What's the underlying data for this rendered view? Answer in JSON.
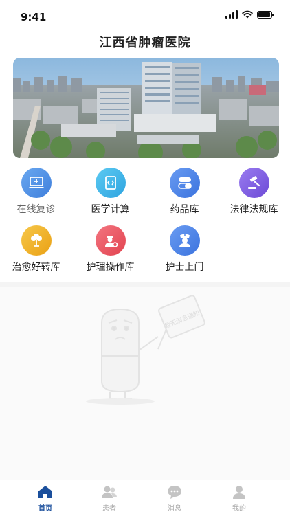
{
  "status_bar": {
    "time": "9:41"
  },
  "header": {
    "title": "江西省肿瘤医院"
  },
  "banner": {
    "alt_icon": "hospital-building-photo"
  },
  "services": [
    {
      "label": "在线复诊",
      "icon": "laptop-plus-icon",
      "color": "#4a8fe0"
    },
    {
      "label": "医学计算",
      "icon": "code-book-icon",
      "color": "#3fb7e8"
    },
    {
      "label": "药品库",
      "icon": "capsule-icon",
      "color": "#4d86e8"
    },
    {
      "label": "法律法规库",
      "icon": "gavel-icon",
      "color": "#7d5be0"
    },
    {
      "label": "治愈好转库",
      "icon": "tree-icon",
      "color": "#f0b428"
    },
    {
      "label": "护理操作库",
      "icon": "nurse-gear-icon",
      "color": "#ee5b67"
    },
    {
      "label": "护士上门",
      "icon": "nurse-icon",
      "color": "#4d86e8"
    }
  ],
  "empty_state": {
    "sign_text": "暂无消息通知"
  },
  "tabbar": {
    "items": [
      {
        "label": "首页",
        "icon": "home-icon",
        "active": true
      },
      {
        "label": "患者",
        "icon": "patients-icon",
        "active": false
      },
      {
        "label": "消息",
        "icon": "message-icon",
        "active": false
      },
      {
        "label": "我的",
        "icon": "profile-icon",
        "active": false
      }
    ],
    "active_color": "#1b4f9c",
    "inactive_color": "#b3b3b3"
  }
}
